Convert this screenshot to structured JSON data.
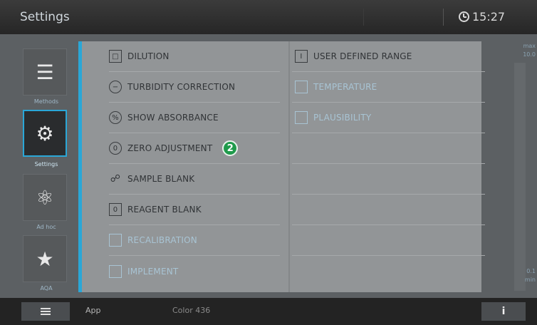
{
  "header": {
    "title": "Settings",
    "time": "15:27"
  },
  "sidebar": {
    "items": [
      {
        "label": "Methods",
        "icon": "methods-icon"
      },
      {
        "label": "Settings",
        "icon": "gear-icon"
      },
      {
        "label": "Ad hoc",
        "icon": "adhoc-icon"
      },
      {
        "label": "AQA",
        "icon": "aqa-icon"
      }
    ]
  },
  "menu": {
    "left": [
      {
        "label": "DILUTION",
        "icon": "dilution-icon"
      },
      {
        "label": "TURBIDITY CORRECTION",
        "icon": "turbidity-icon"
      },
      {
        "label": "SHOW ABSORBANCE",
        "icon": "absorbance-icon"
      },
      {
        "label": "ZERO ADJUSTMENT",
        "icon": "zero-adjustment-icon",
        "badge": "2"
      },
      {
        "label": "SAMPLE BLANK",
        "icon": "sample-blank-icon"
      },
      {
        "label": "REAGENT BLANK",
        "icon": "reagent-blank-icon"
      },
      {
        "label": "RECALIBRATION",
        "icon": "recalibration-icon"
      },
      {
        "label": "IMPLEMENT",
        "icon": "implement-icon"
      }
    ],
    "right": [
      {
        "label": "USER DEFINED RANGE",
        "icon": "range-icon"
      },
      {
        "label": "TEMPERATURE",
        "icon": "temperature-icon"
      },
      {
        "label": "PLAUSIBILITY",
        "icon": "plausibility-icon"
      }
    ]
  },
  "scale": {
    "max_label": "max",
    "max_value": "10.0",
    "min_value": "0.1",
    "min_label": "min"
  },
  "footer": {
    "app_label": "App",
    "color_label": "Color 436",
    "info_label": "i"
  },
  "colors": {
    "accent": "#2aa7d7",
    "badge": "#1f9a4b"
  }
}
